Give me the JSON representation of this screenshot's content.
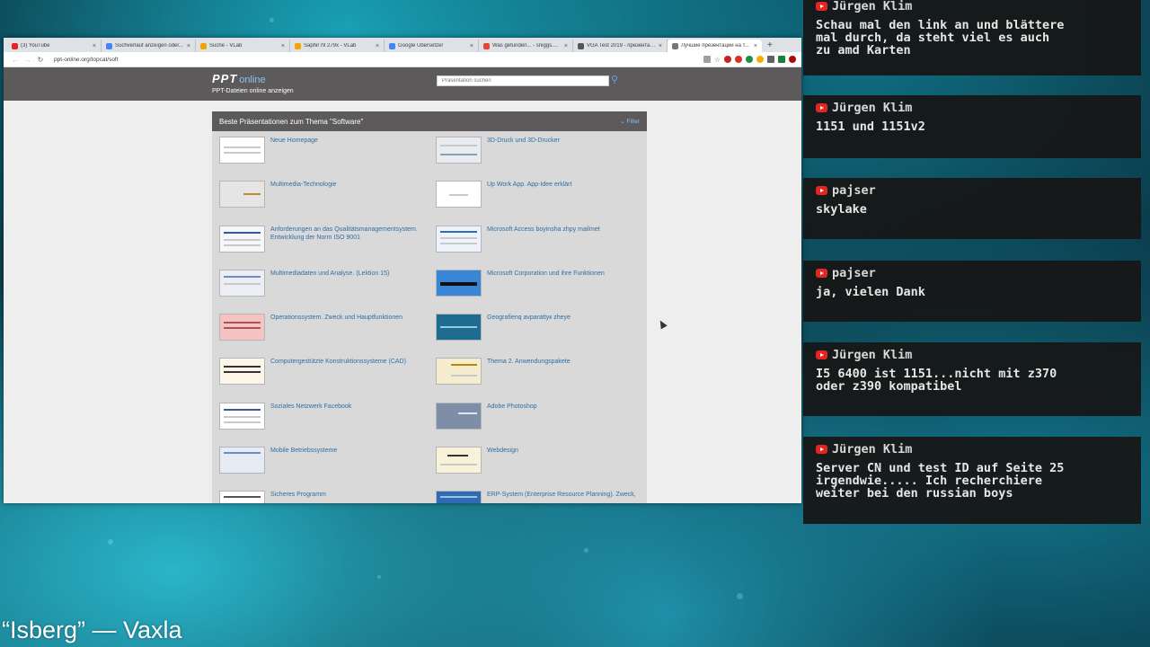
{
  "browser": {
    "tabs": [
      {
        "label": "(3) YouTube",
        "color": "#e52521"
      },
      {
        "label": "Suchverlauf anzeigen oder...",
        "color": "#4285f4"
      },
      {
        "label": "Suche - VLab",
        "color": "#f4a300"
      },
      {
        "label": "Saphir r9 279x - VLab",
        "color": "#f4a300"
      },
      {
        "label": "Google Übersetzer",
        "color": "#4285f4"
      },
      {
        "label": "Was gefunden... - sniggs.bar...",
        "color": "#ea4335"
      },
      {
        "label": "VGA Test 2019 - презентац...",
        "color": "#555555"
      },
      {
        "label": "Лучшие презентации на т...",
        "color": "#777777"
      }
    ],
    "new_tab": "+",
    "url": "ppt-online.org/topcat/soft"
  },
  "site": {
    "logo_ppt": "PPT",
    "logo_online": "online",
    "tagline": "PPT-Dateien online anzeigen",
    "search_placeholder": "Präsentation suchen"
  },
  "panel": {
    "heading": "Beste Präsentationen zum Thema \"Software\"",
    "filter": "Filter",
    "items": [
      {
        "title": "Neue Homepage",
        "thumb": "#ffffff"
      },
      {
        "title": "3D-Druck und 3D-Drucker",
        "thumb": "#e8ecf0"
      },
      {
        "title": "Multimedia-Technologie",
        "thumb": "#e5e5e5"
      },
      {
        "title": "Up Work App. App-Idee erklärt",
        "thumb": "#ffffff"
      },
      {
        "title": "Anforderungen an das Qualitätsmanagementsystem. Entwicklung der Norm ISO 9001",
        "thumb": "#f4f6fa"
      },
      {
        "title": "Microsoft Access boyinsha zhpy mailmet",
        "thumb": "#eef3fb"
      },
      {
        "title": "Multimediadaten und Analyse. (Lektion 15)",
        "thumb": "#ebeff5"
      },
      {
        "title": "Microsoft Corporation und ihre Funktionen",
        "thumb": "#3a86d6"
      },
      {
        "title": "Operationssystem. Zweck und Hauptfunktionen",
        "thumb": "#f6c3c3"
      },
      {
        "title": "Geografienq avparattyк zheye",
        "thumb": "#1f6c93"
      },
      {
        "title": "Computergestützte Konstruktionssysteme (CAD)",
        "thumb": "#fbf6e8"
      },
      {
        "title": "Thema 2. Anwendungspakete",
        "thumb": "#f6ecd0"
      },
      {
        "title": "Soziales Netzwerk Facebook",
        "thumb": "#ffffff"
      },
      {
        "title": "Adobe Photoshop",
        "thumb": "#7f8ea8"
      },
      {
        "title": "Mobile Betriebssysteme",
        "thumb": "#e6ecf4"
      },
      {
        "title": "Webdesign",
        "thumb": "#f7f2d9"
      },
      {
        "title": "Sicheres Programm",
        "thumb": "#ffffff"
      },
      {
        "title": "ERP-System (Enterprise Resource Planning). Zweck,",
        "thumb": "#2e6bb0"
      }
    ]
  },
  "chat": {
    "messages": [
      {
        "author": "Jürgen Klim",
        "text": "Schau mal den link an und blättere\nmal durch, da steht viel es auch\nzu amd Karten"
      },
      {
        "author": "Jürgen Klim",
        "text": "1151 und 1151v2"
      },
      {
        "author": "pajser",
        "text": "skylake"
      },
      {
        "author": "pajser",
        "text": "ja, vielen Dank"
      },
      {
        "author": "Jürgen Klim",
        "text": "I5 6400 ist 1151...nicht mit z370\noder z390 kompatibel"
      },
      {
        "author": "Jürgen Klim",
        "text": "Server CN und test ID auf Seite 25\nirgendwie..... Ich recherchiere\nweiter bei den russian boys"
      }
    ]
  },
  "now_playing": "“Isberg” — Vaxla"
}
